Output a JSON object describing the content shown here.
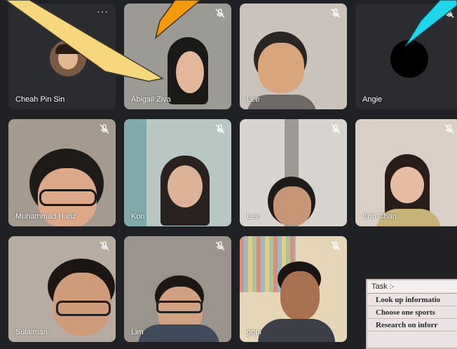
{
  "participants": [
    {
      "name": "Cheah Pin Sin"
    },
    {
      "name": "Abigail Ziva"
    },
    {
      "name": "Lee"
    },
    {
      "name": "Angie"
    },
    {
      "name": "Muhammad Hariz"
    },
    {
      "name": "Kon"
    },
    {
      "name": "Lee"
    },
    {
      "name": "Erin Chan"
    },
    {
      "name": "Sulaiman"
    },
    {
      "name": "Lim"
    },
    {
      "name": "gopi"
    }
  ],
  "more_options": "···",
  "task": {
    "header": "Task :-",
    "lines": [
      "Look up informatio",
      "Choose one sports",
      "Research on inforr"
    ]
  },
  "colors": {
    "background": "#202124",
    "tile": "#3c4043",
    "arrow_yellow": "#f7d77c",
    "arrow_orange": "#f59a0a",
    "arrow_cyan": "#1fd6ea"
  }
}
